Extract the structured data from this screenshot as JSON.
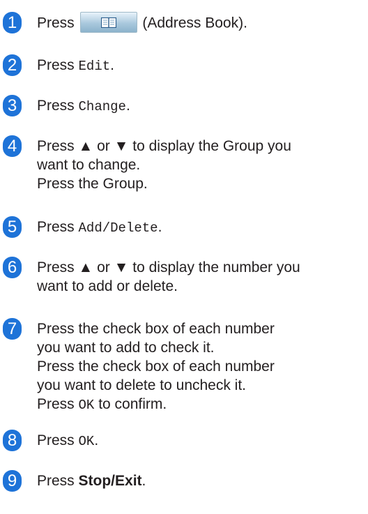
{
  "step_badge_color": "#1e73d8",
  "steps": [
    {
      "num": "1",
      "pre": "Press",
      "post": "(Address Book).",
      "icon": "address-book-icon"
    },
    {
      "num": "2",
      "pre": "Press",
      "code": "Edit",
      "post": "."
    },
    {
      "num": "3",
      "pre": "Press",
      "code": "Change",
      "post": "."
    },
    {
      "num": "4",
      "lines": [
        "Press ▲ or ▼ to display the Group you",
        "want to change.",
        "Press the Group."
      ]
    },
    {
      "num": "5",
      "pre": "Press",
      "code": "Add/Delete",
      "post": "."
    },
    {
      "num": "6",
      "lines": [
        "Press ▲ or ▼ to display the number you",
        "want to add or delete."
      ]
    },
    {
      "num": "7",
      "lines": [
        "Press the check box of each number",
        "you want to add to check it.",
        "Press the check box of each number",
        "you want to delete to uncheck it."
      ],
      "last_pre": "Press",
      "last_code": "OK",
      "last_post": "to confirm."
    },
    {
      "num": "8",
      "pre": "Press",
      "code": "OK",
      "post": "."
    },
    {
      "num": "9",
      "pre": "Press",
      "bold": "Stop/Exit",
      "post": "."
    }
  ]
}
